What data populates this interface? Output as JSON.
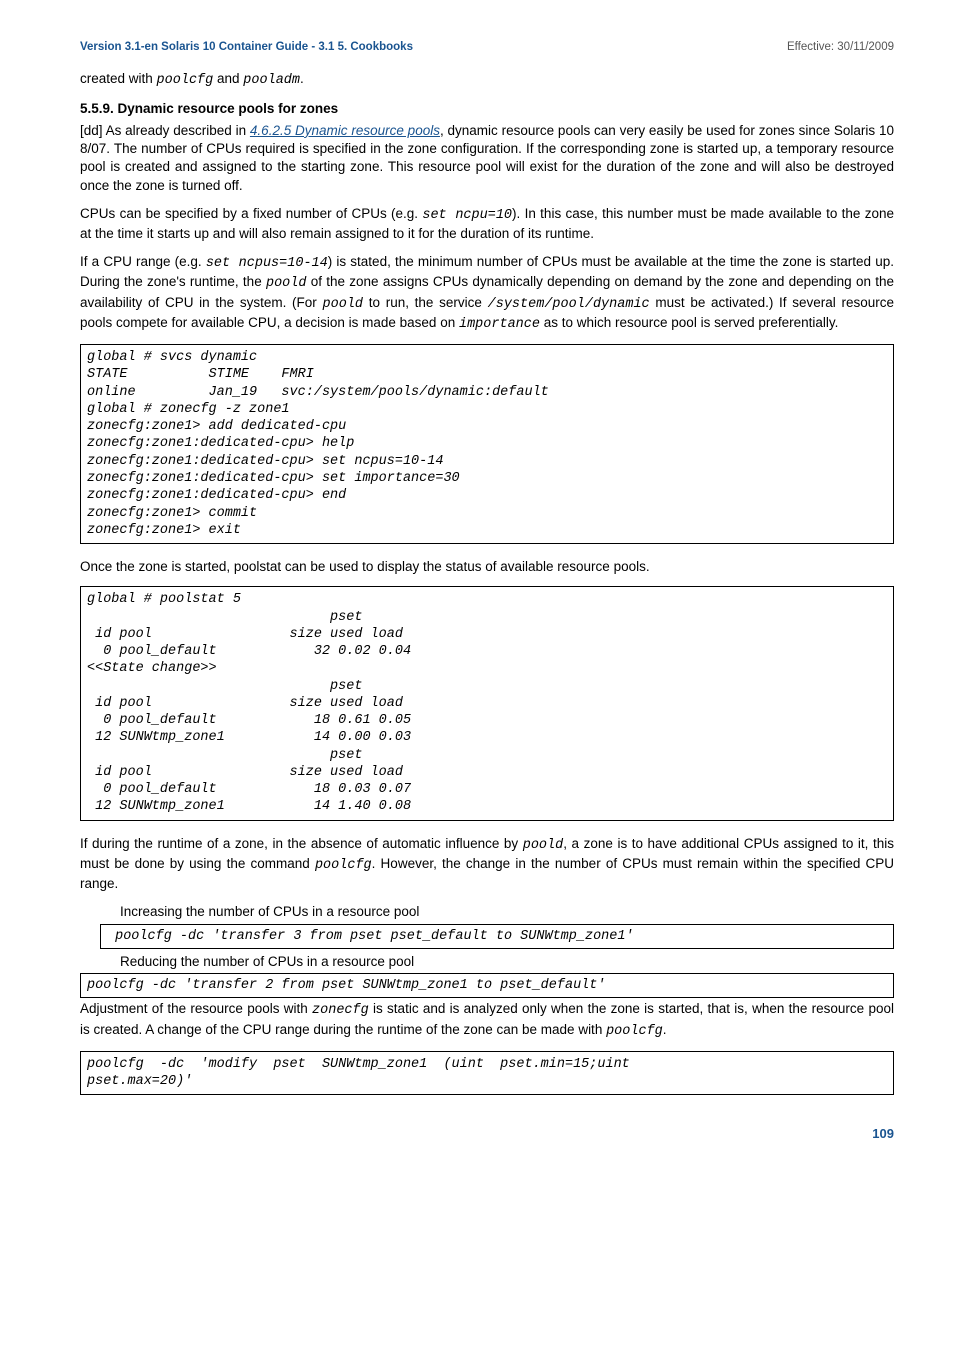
{
  "header": {
    "left_bold": "Version 3.1-en",
    "left_thin": " Solaris 10 Container Guide - 3.1  5. Cookbooks",
    "right": "Effective: 30/11/2009"
  },
  "intro_line_pre": "created with ",
  "intro_code1": "poolcfg",
  "intro_line_mid": " and ",
  "intro_code2": "pooladm",
  "intro_line_post": ".",
  "heading": "5.5.9. Dynamic resource pools for zones",
  "para1_pre": "[dd] As already described in ",
  "para1_link": "4.6.2.5 Dynamic resource pools",
  "para1_post": ", dynamic resource pools can very easily be used for zones since Solaris 10 8/07. The number of CPUs required is specified in the zone configuration. If the corresponding zone is started up, a temporary resource pool is created  and assigned to the starting zone. This resource pool will exist for the duration of the zone and will also be destroyed once the zone is turned off.",
  "para2_a": "CPUs can be specified by a fixed number of CPUs (e.g. ",
  "para2_code": "set ncpu=10",
  "para2_b": "). In this case, this number must be made available to the zone at the time it starts up and will also remain assigned to it for the duration of its runtime.",
  "para3_a": "If a CPU range (e.g. ",
  "para3_code1": "set ncpus=10-14",
  "para3_b": ") is stated, the minimum number of CPUs must be available at the time the zone is started up. During the zone's runtime, the ",
  "para3_code2": "poold",
  "para3_c": " of the zone assigns CPUs dynamically depending on demand by the zone and depending on the availability of CPU in the system. (For ",
  "para3_code3": "poold",
  "para3_d": " to run, the service ",
  "para3_code4": "/system/pool/dynamic",
  "para3_e": " must be activated.) If several resource pools compete for available CPU, a decision is made based on ",
  "para3_code5": "importance",
  "para3_f": " as to which resource pool is served preferentially.",
  "codebox1": "global # svcs dynamic\nSTATE          STIME    FMRI\nonline         Jan_19   svc:/system/pools/dynamic:default\nglobal # zonecfg -z zone1\nzonecfg:zone1> add dedicated-cpu\nzonecfg:zone1:dedicated-cpu> help\nzonecfg:zone1:dedicated-cpu> set ncpus=10-14\nzonecfg:zone1:dedicated-cpu> set importance=30\nzonecfg:zone1:dedicated-cpu> end\nzonecfg:zone1> commit\nzonecfg:zone1> exit",
  "para4": "Once the zone is started, poolstat can be used to display the status of available resource pools.",
  "codebox2": "global # poolstat 5\n                              pset\n id pool                 size used load\n  0 pool_default            32 0.02 0.04\n<<State change>>\n                              pset\n id pool                 size used load\n  0 pool_default            18 0.61 0.05\n 12 SUNWtmp_zone1           14 0.00 0.03\n                              pset\n id pool                 size used load\n  0 pool_default            18 0.03 0.07\n 12 SUNWtmp_zone1           14 1.40 0.08",
  "para5_a": "If during the runtime of a zone, in the absence of automatic influence by ",
  "para5_code1": "poold",
  "para5_b": ", a zone is to have additional CPUs assigned to it, this must be done by using the command ",
  "para5_code2": "poolcfg",
  "para5_c": ". However, the change in the number of CPUs must remain within the specified CPU range.",
  "label_increase": "Increasing the number of CPUs in a resource pool",
  "codebox3": " poolcfg -dc 'transfer 3 from pset pset_default to SUNWtmp_zone1'",
  "label_reduce": "Reducing the number of CPUs in a resource pool",
  "codebox4": "poolcfg -dc 'transfer 2 from pset SUNWtmp_zone1 to pset_default'",
  "para6_a": "Adjustment of the resource pools with ",
  "para6_code1": "zonecfg",
  "para6_b": " is static and is analyzed only when the zone is started, that is, when the resource pool is created. A change of the CPU range during the runtime of the zone can be made with ",
  "para6_code2": "poolcfg",
  "para6_c": ".",
  "codebox5": "poolcfg  -dc  'modify  pset  SUNWtmp_zone1  (uint  pset.min=15;uint\npset.max=20)'",
  "page_num": "109",
  "chart_data": {
    "type": "table",
    "title": "poolstat 5 output",
    "columns": [
      "id",
      "pool",
      "size",
      "used",
      "load"
    ],
    "snapshots": [
      {
        "rows": [
          {
            "id": 0,
            "pool": "pool_default",
            "size": 32,
            "used": 0.02,
            "load": 0.04
          }
        ]
      },
      {
        "rows": [
          {
            "id": 0,
            "pool": "pool_default",
            "size": 18,
            "used": 0.61,
            "load": 0.05
          },
          {
            "id": 12,
            "pool": "SUNWtmp_zone1",
            "size": 14,
            "used": 0.0,
            "load": 0.03
          }
        ]
      },
      {
        "rows": [
          {
            "id": 0,
            "pool": "pool_default",
            "size": 18,
            "used": 0.03,
            "load": 0.07
          },
          {
            "id": 12,
            "pool": "SUNWtmp_zone1",
            "size": 14,
            "used": 1.4,
            "load": 0.08
          }
        ]
      }
    ]
  }
}
